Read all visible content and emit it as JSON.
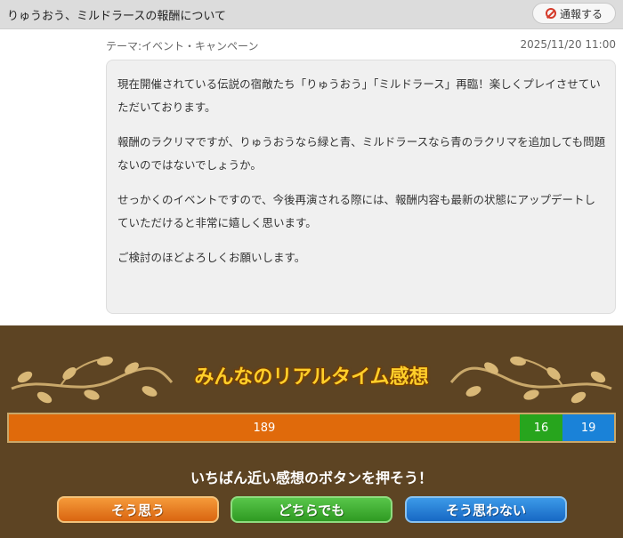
{
  "header": {
    "title": "りゅうおう、ミルドラースの報酬について",
    "report_label": "通報する"
  },
  "meta": {
    "theme": "テーマ:イベント・キャンペーン",
    "timestamp": "2025/11/20 11:00"
  },
  "message": {
    "paragraphs": [
      "現在開催されている伝説の宿敵たち「りゅうおう」「ミルドラース」再臨！楽しくプレイさせていただいております。",
      "報酬のラクリマですが、りゅうおうなら緑と青、ミルドラースなら青のラクリマを追加しても問題ないのではないでしょうか。",
      "せっかくのイベントですので、今後再演される際には、報酬内容も最新の状態にアップデートしていただけると非常に嬉しく思います。",
      "ご検討のほどよろしくお願いします。"
    ]
  },
  "reactions": {
    "title": "みんなのリアルタイム感想",
    "counts": {
      "agree": "189",
      "neutral": "16",
      "disagree": "19"
    },
    "prompt": "いちばん近い感想のボタンを押そう！",
    "buttons": {
      "agree": "そう思う",
      "neutral": "どちらでも",
      "disagree": "そう思わない"
    },
    "colors": {
      "agree": "#e06a0b",
      "neutral": "#27a51d",
      "disagree": "#1a82d8",
      "panel": "#5d4423",
      "title": "#ffcf2a"
    }
  }
}
